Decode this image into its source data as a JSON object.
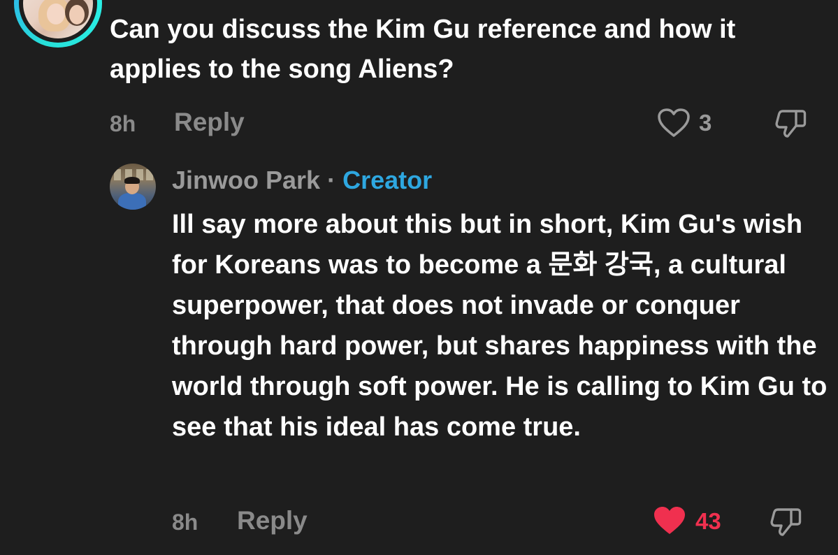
{
  "top_comment": {
    "text": "Can you discuss the Kim Gu reference and how it applies to the song Aliens?",
    "timestamp": "8h",
    "reply_label": "Reply",
    "like_count": "3",
    "liked": false
  },
  "reply_comment": {
    "author": "Jinwoo Park",
    "separator": "·",
    "badge": "Creator",
    "text": "Ill say more about this but in short, Kim Gu's wish for Koreans was to become a 문화 강국, a cultural superpower, that does not invade or conquer through hard power, but shares happiness with the world through soft power. He is calling to Kim Gu to see that his ideal has come true.",
    "timestamp": "8h",
    "reply_label": "Reply",
    "like_count": "43",
    "liked": true
  },
  "colors": {
    "background": "#1e1e1e",
    "text_primary": "#ffffff",
    "text_secondary": "#8a8a8a",
    "creator_badge": "#2ea7e0",
    "liked_heart": "#f0304f",
    "avatar_ring": "#27e0d9"
  },
  "icons": {
    "like": "heart-outline-icon",
    "liked": "heart-filled-icon",
    "dislike": "thumbs-down-icon"
  }
}
